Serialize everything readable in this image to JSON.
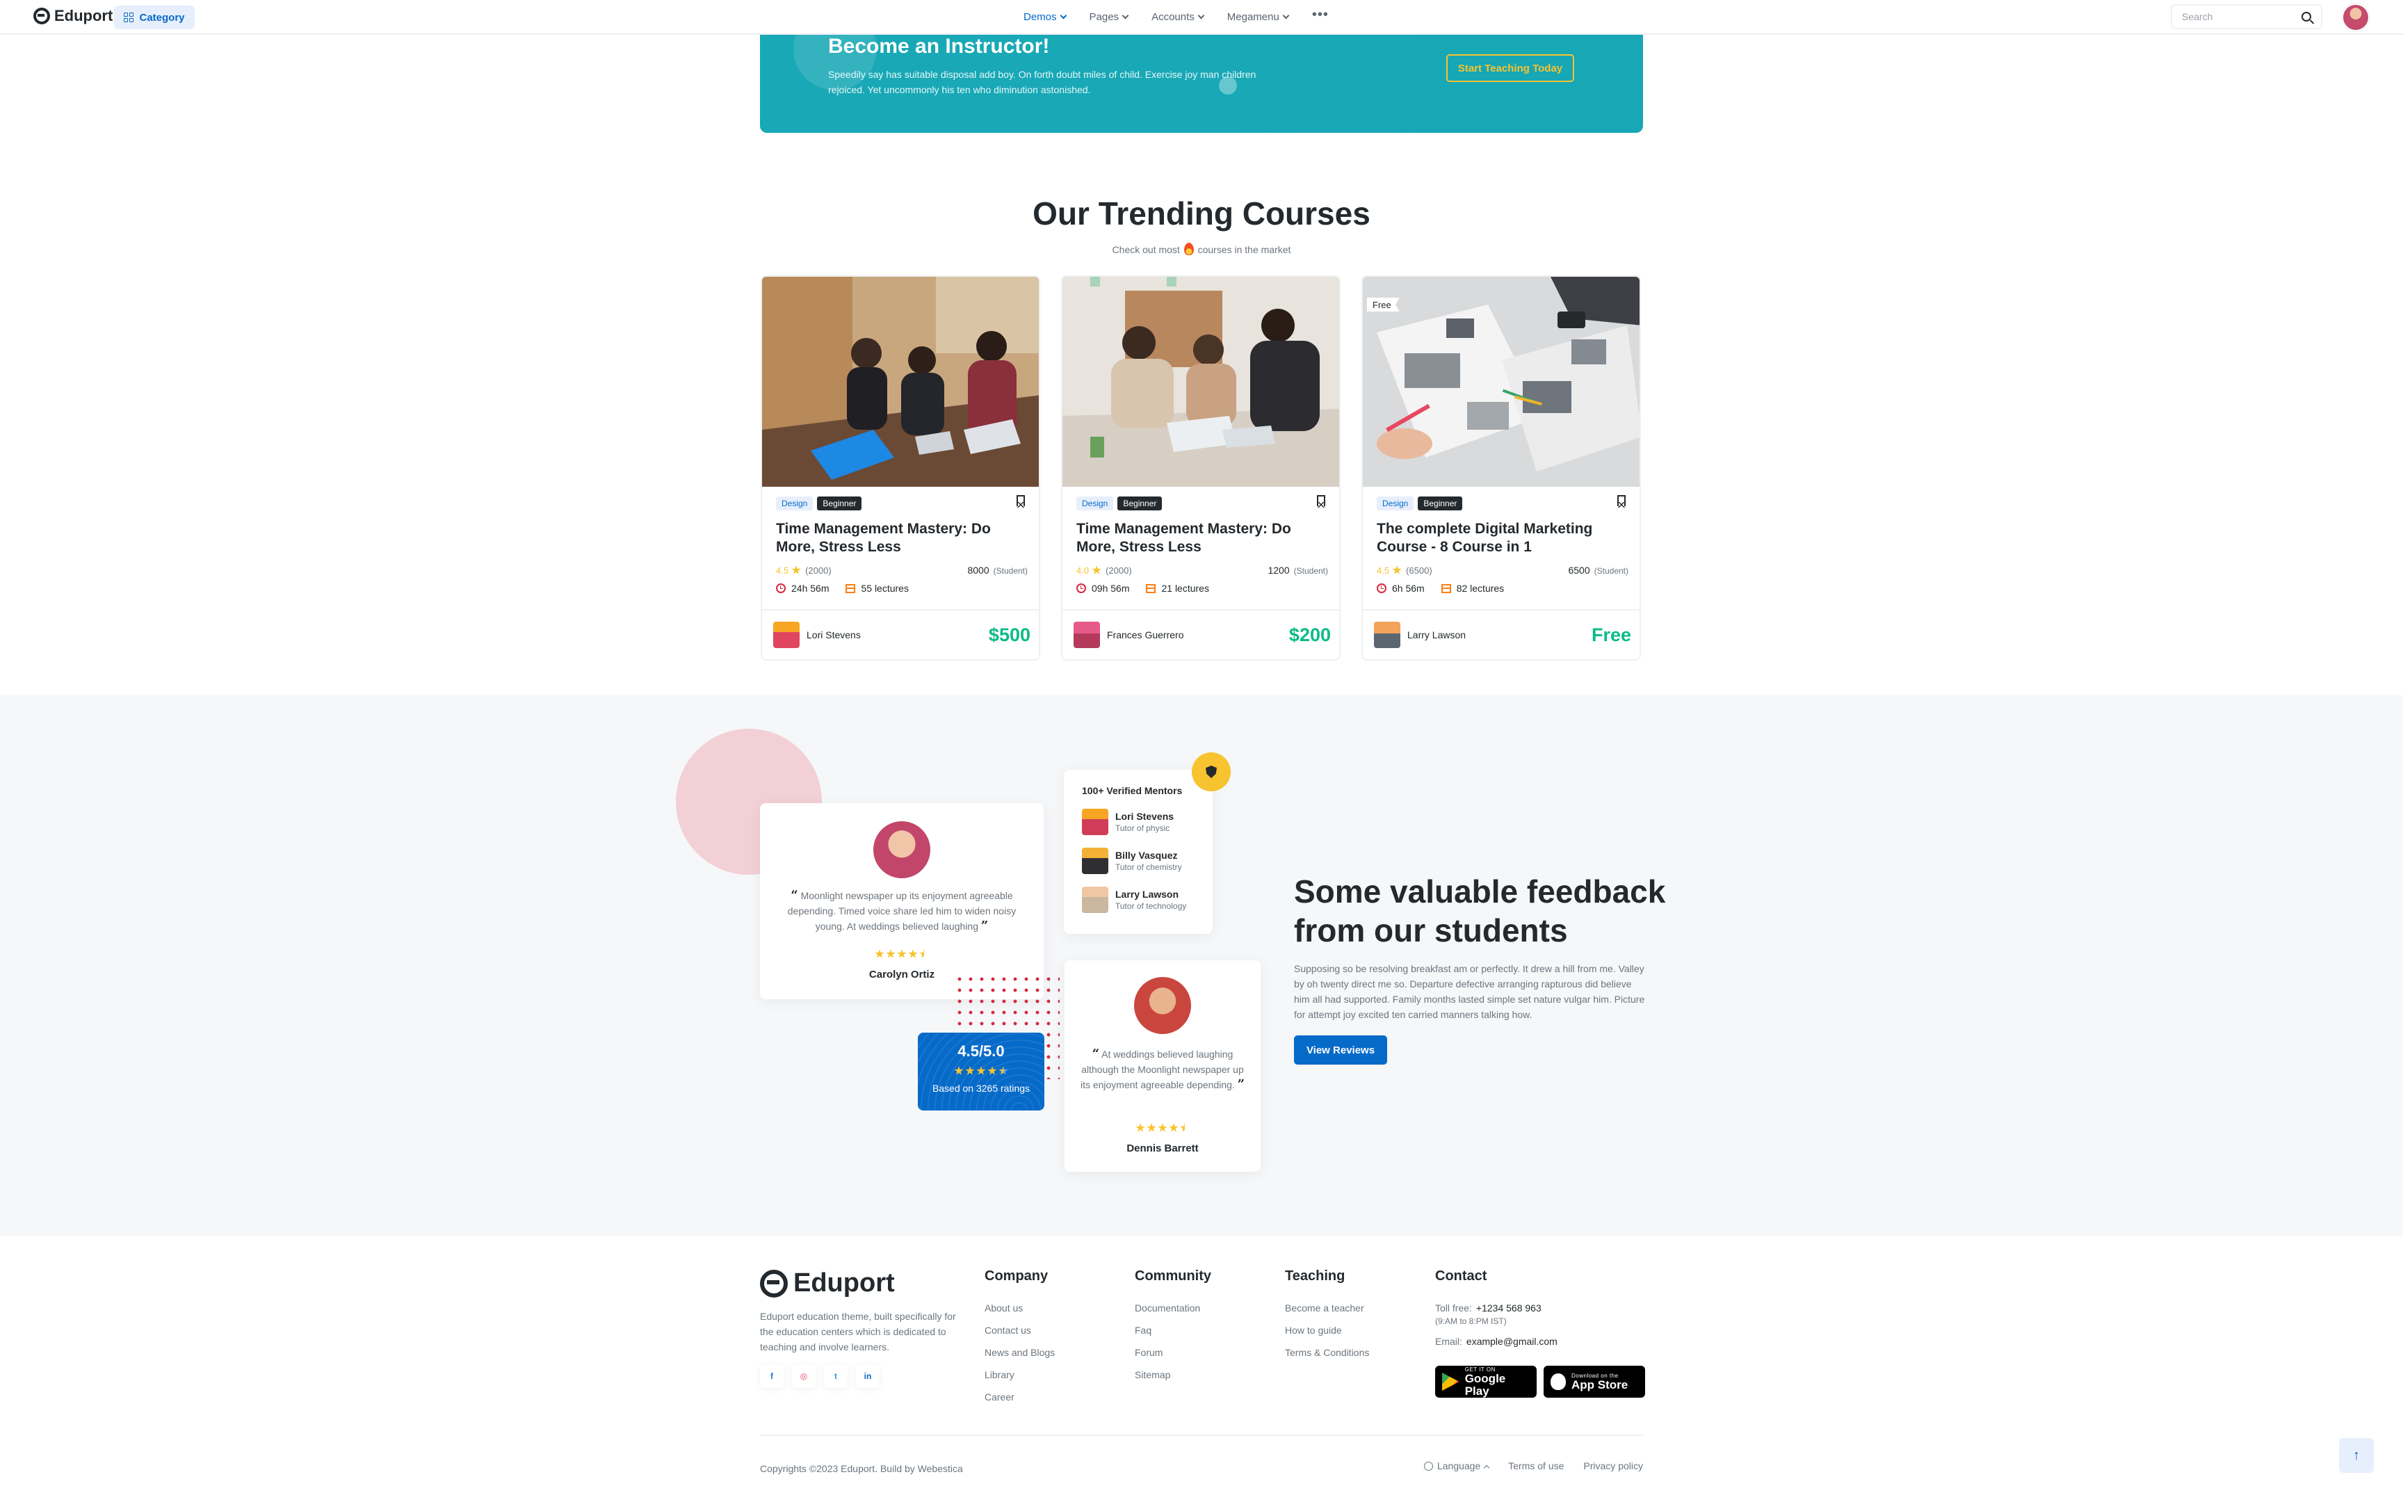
{
  "navbar": {
    "brand": "Eduport",
    "category_label": "Category",
    "menu": [
      {
        "label": "Demos"
      },
      {
        "label": "Pages"
      },
      {
        "label": "Accounts"
      },
      {
        "label": "Megamenu"
      }
    ],
    "more_label": "•••",
    "search_placeholder": "Search"
  },
  "instructor": {
    "title": "Become an Instructor!",
    "text": "Speedily say has suitable disposal add boy. On forth doubt miles of child. Exercise joy man children rejoiced. Yet uncommonly his ten who diminution astonished.",
    "button": "Start Teaching Today"
  },
  "trending": {
    "title": "Our Trending Courses",
    "subtitle_before": "Check out most",
    "subtitle_after": "courses in the market",
    "courses": [
      {
        "tag": "Design",
        "level": "Beginner",
        "badge": "",
        "title": "Time Management Mastery: Do More, Stress Less",
        "rating": "4.5",
        "reviews": "(2000)",
        "students": "8000",
        "students_label": "(Student)",
        "duration": "24h 56m",
        "lectures": "55 lectures",
        "instructor": "Lori Stevens",
        "price": "$500"
      },
      {
        "tag": "Design",
        "level": "Beginner",
        "badge": "",
        "title": "Time Management Mastery: Do More, Stress Less",
        "rating": "4.0",
        "reviews": "(2000)",
        "students": "1200",
        "students_label": "(Student)",
        "duration": "09h 56m",
        "lectures": "21 lectures",
        "instructor": "Frances Guerrero",
        "price": "$200"
      },
      {
        "tag": "Design",
        "level": "Beginner",
        "badge": "Free",
        "title": "The complete Digital Marketing Course - 8 Course in 1",
        "rating": "4.5",
        "reviews": "(6500)",
        "students": "6500",
        "students_label": "(Student)",
        "duration": "6h 56m",
        "lectures": "82 lectures",
        "instructor": "Larry Lawson",
        "price": "Free"
      }
    ]
  },
  "feedback": {
    "testimonial_1": {
      "quote": "Moonlight newspaper up its enjoyment agreeable depending. Timed voice share led him to widen noisy young. At weddings believed laughing",
      "name": "Carolyn Ortiz",
      "stars": 4.5
    },
    "testimonial_2": {
      "quote": "At weddings believed laughing although the Moonlight newspaper up its enjoyment agreeable depending.",
      "name": "Dennis Barrett",
      "stars": 4.5
    },
    "mentors": {
      "title": "100+ Verified Mentors",
      "items": [
        {
          "name": "Lori Stevens",
          "role": "Tutor of physic"
        },
        {
          "name": "Billy Vasquez",
          "role": "Tutor of chemistry"
        },
        {
          "name": "Larry Lawson",
          "role": "Tutor of technology"
        }
      ]
    },
    "rating_box": {
      "value": "4.5/5.0",
      "stars": 4.5,
      "subtitle": "Based on 3265 ratings"
    },
    "title": "Some valuable feedback from our students",
    "text": "Supposing so be resolving breakfast am or perfectly. It drew a hill from me. Valley by oh twenty direct me so. Departure defective arranging rapturous did believe him all had supported. Family months lasted simple set nature vulgar him. Picture for attempt joy excited ten carried manners talking how.",
    "button": "View Reviews"
  },
  "footer": {
    "brand": "Eduport",
    "about": "Eduport education theme, built specifically for the education centers which is dedicated to teaching and involve learners.",
    "socials": [
      "f",
      "◎",
      "t",
      "in"
    ],
    "columns": [
      {
        "title": "Company",
        "links": [
          "About us",
          "Contact us",
          "News and Blogs",
          "Library",
          "Career"
        ]
      },
      {
        "title": "Community",
        "links": [
          "Documentation",
          "Faq",
          "Forum",
          "Sitemap"
        ]
      },
      {
        "title": "Teaching",
        "links": [
          "Become a teacher",
          "How to guide",
          "Terms & Conditions"
        ]
      }
    ],
    "contact": {
      "title": "Contact",
      "toll_label": "Toll free:",
      "toll": "+1234 568 963",
      "hours": "(9:AM to 8:PM IST)",
      "email_label": "Email:",
      "email": "example@gmail.com"
    },
    "google_play": {
      "small": "GET IT ON",
      "big": "Google Play"
    },
    "app_store": {
      "small": "Download on the",
      "big": "App Store"
    },
    "copyright": "Copyrights ©2023 Eduport. Build by Webestica",
    "language": "Language",
    "terms": "Terms of use",
    "privacy": "Privacy policy"
  },
  "colors": {
    "primary": "#066ac9",
    "teal": "#17a7b5",
    "warning": "#f7c32e",
    "success": "#0cbc87",
    "danger": "#d6293e"
  }
}
